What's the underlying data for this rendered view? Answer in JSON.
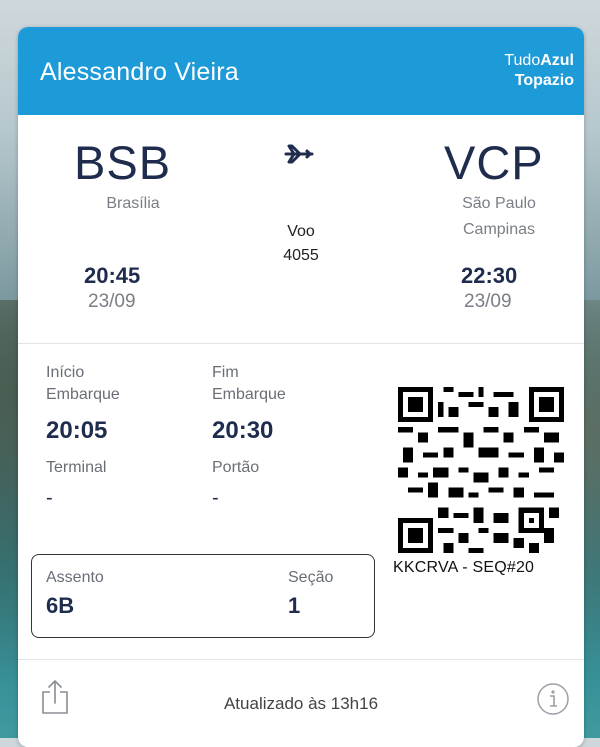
{
  "header": {
    "passenger_name": "Alessandro Vieira",
    "loyalty_brand_prefix": "Tudo",
    "loyalty_brand_suffix": "Azul",
    "loyalty_tier": "Topazio"
  },
  "origin": {
    "code": "BSB",
    "city": "Brasília",
    "time": "20:45",
    "date": "23/09"
  },
  "destination": {
    "code": "VCP",
    "city_line1": "São Paulo",
    "city_line2": "Campinas",
    "time": "22:30",
    "date": "23/09"
  },
  "flight": {
    "label": "Voo",
    "number": "4055"
  },
  "boarding": {
    "start_label_line1": "Início",
    "start_label_line2": "Embarque",
    "start_time": "20:05",
    "end_label_line1": "Fim",
    "end_label_line2": "Embarque",
    "end_time": "20:30",
    "terminal_label": "Terminal",
    "terminal_value": "-",
    "gate_label": "Portão",
    "gate_value": "-"
  },
  "booking": {
    "code_text": "KKCRVA - SEQ#20"
  },
  "seat": {
    "seat_label": "Assento",
    "seat_value": "6B",
    "section_label": "Seção",
    "section_value": "1"
  },
  "footer": {
    "updated_text": "Atualizado às 13h16",
    "share_icon": "share-icon",
    "info_icon": "info-icon"
  },
  "colors": {
    "header_bg": "#1d9bd8",
    "accent_text": "#1f2c4d",
    "muted_text": "#7a7e85"
  }
}
